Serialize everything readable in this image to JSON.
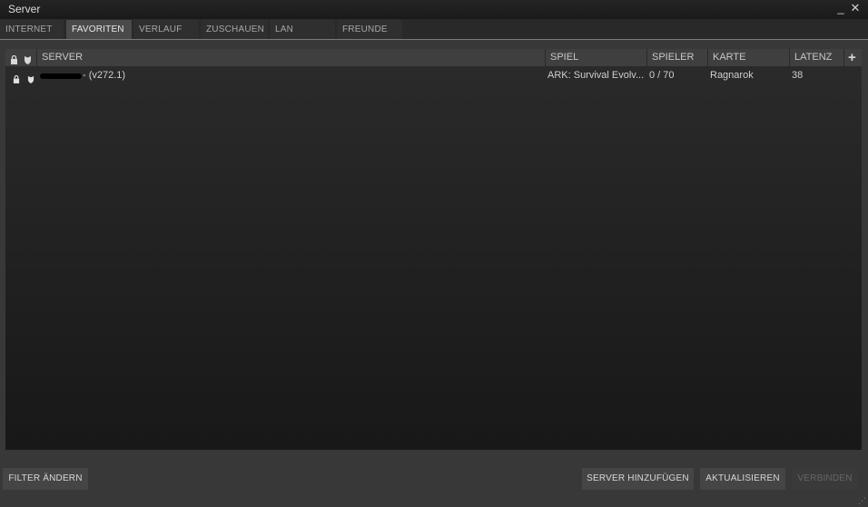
{
  "window": {
    "title": "Server",
    "minimize_icon": "minimize-icon",
    "close_icon": "close-icon"
  },
  "tabs": [
    {
      "label": "INTERNET",
      "active": false
    },
    {
      "label": "FAVORITEN",
      "active": true
    },
    {
      "label": "VERLAUF",
      "active": false
    },
    {
      "label": "ZUSCHAUEN",
      "active": false
    },
    {
      "label": "LAN",
      "active": false
    },
    {
      "label": "FREUNDE",
      "active": false
    }
  ],
  "table": {
    "columns": {
      "lock": "lock-icon",
      "secure": "shield-icon",
      "server": "SERVER",
      "game": "SPIEL",
      "players": "SPIELER",
      "map": "KARTE",
      "latency": "LATENZ",
      "add": "+"
    },
    "rows": [
      {
        "locked": true,
        "secure": true,
        "server": "- (v272.1)",
        "game": "ARK: Survival Evolv...",
        "players": "0 / 70",
        "map": "Ragnarok",
        "latency": "38"
      }
    ]
  },
  "buttons": {
    "change_filter": "FILTER ÄNDERN",
    "add_server": "SERVER HINZUFÜGEN",
    "refresh": "AKTUALISIEREN",
    "connect": "VERBINDEN"
  },
  "colors": {
    "window_bg": "#383838",
    "panel_bg": "#1c1c1c",
    "active_tab": "#4a4a4a"
  }
}
